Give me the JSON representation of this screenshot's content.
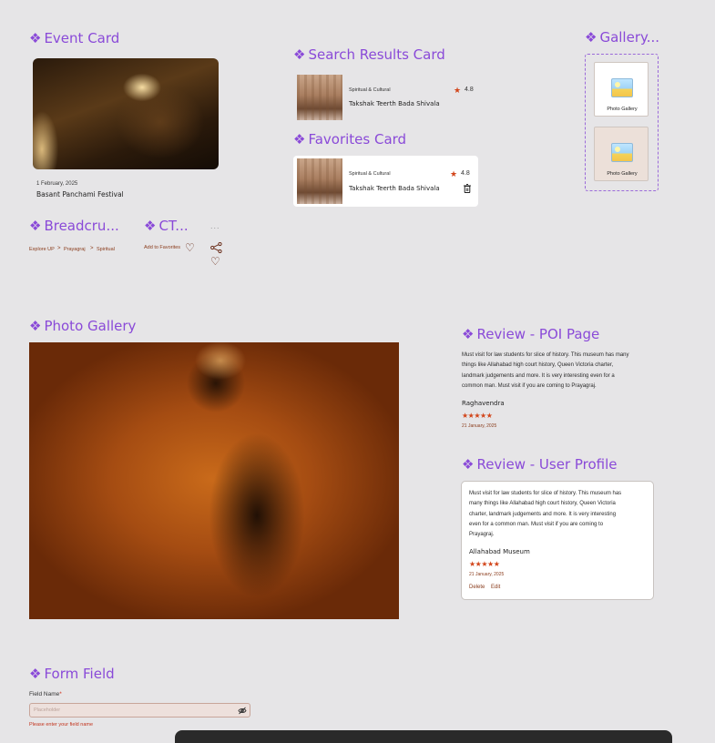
{
  "sections": {
    "event_card": "Event Card",
    "search_results": "Search Results Card",
    "favorites": "Favorites Card",
    "gallery": "Gallery...",
    "breadcrumb": "Breadcru...",
    "cta": "CT...",
    "photo_gallery": "Photo Gallery",
    "review_poi": "Review - POI Page",
    "review_profile": "Review - User Profile",
    "form_field": "Form Field"
  },
  "event": {
    "date": "1 February, 2025",
    "name": "Basant Panchami Festival"
  },
  "search_result": {
    "category": "Spiritual & Cultural",
    "name": "Takshak Teerth Bada Shivala",
    "rating": "4.8"
  },
  "favorite": {
    "category": "Spiritual & Cultural",
    "name": "Takshak Teerth Bada Shivala",
    "rating": "4.8"
  },
  "gallery": {
    "tiles": [
      "Photo Gallery",
      "Photo Gallery"
    ]
  },
  "breadcrumb": {
    "items": [
      "Explore UP",
      "Prayagraj",
      "Spiritual"
    ],
    "separator": ">"
  },
  "cta": {
    "label": "Add to Favorites",
    "more": "..."
  },
  "review_poi": {
    "lines": [
      "Must visit for law students for slice of history. This museum has many",
      "things like Allahabad high court history, Queen Victoria charter,",
      "landmark judgements and more. It is very interesting even for a",
      "common man. Must visit if you are coming to Prayagraj."
    ],
    "author": "Raghavendra",
    "stars": "★★★★★",
    "date": "21 January, 2025"
  },
  "review_profile": {
    "lines": [
      "Must visit for law students for slice of history. This museum has",
      "many things like Allahabad high court history, Queen Victoria",
      "charter, landmark judgements and more. It is very interesting",
      "even for a common man. Must visit if you are coming to",
      "Prayagraj."
    ],
    "place": "Allahabad Museum",
    "stars": "★★★★★",
    "date": "21 January, 2025",
    "delete_label": "Delete",
    "edit_label": "Edit"
  },
  "form": {
    "label": "Field Name",
    "required_mark": "*",
    "placeholder": "Placeholder",
    "error": "Please enter your field name"
  }
}
